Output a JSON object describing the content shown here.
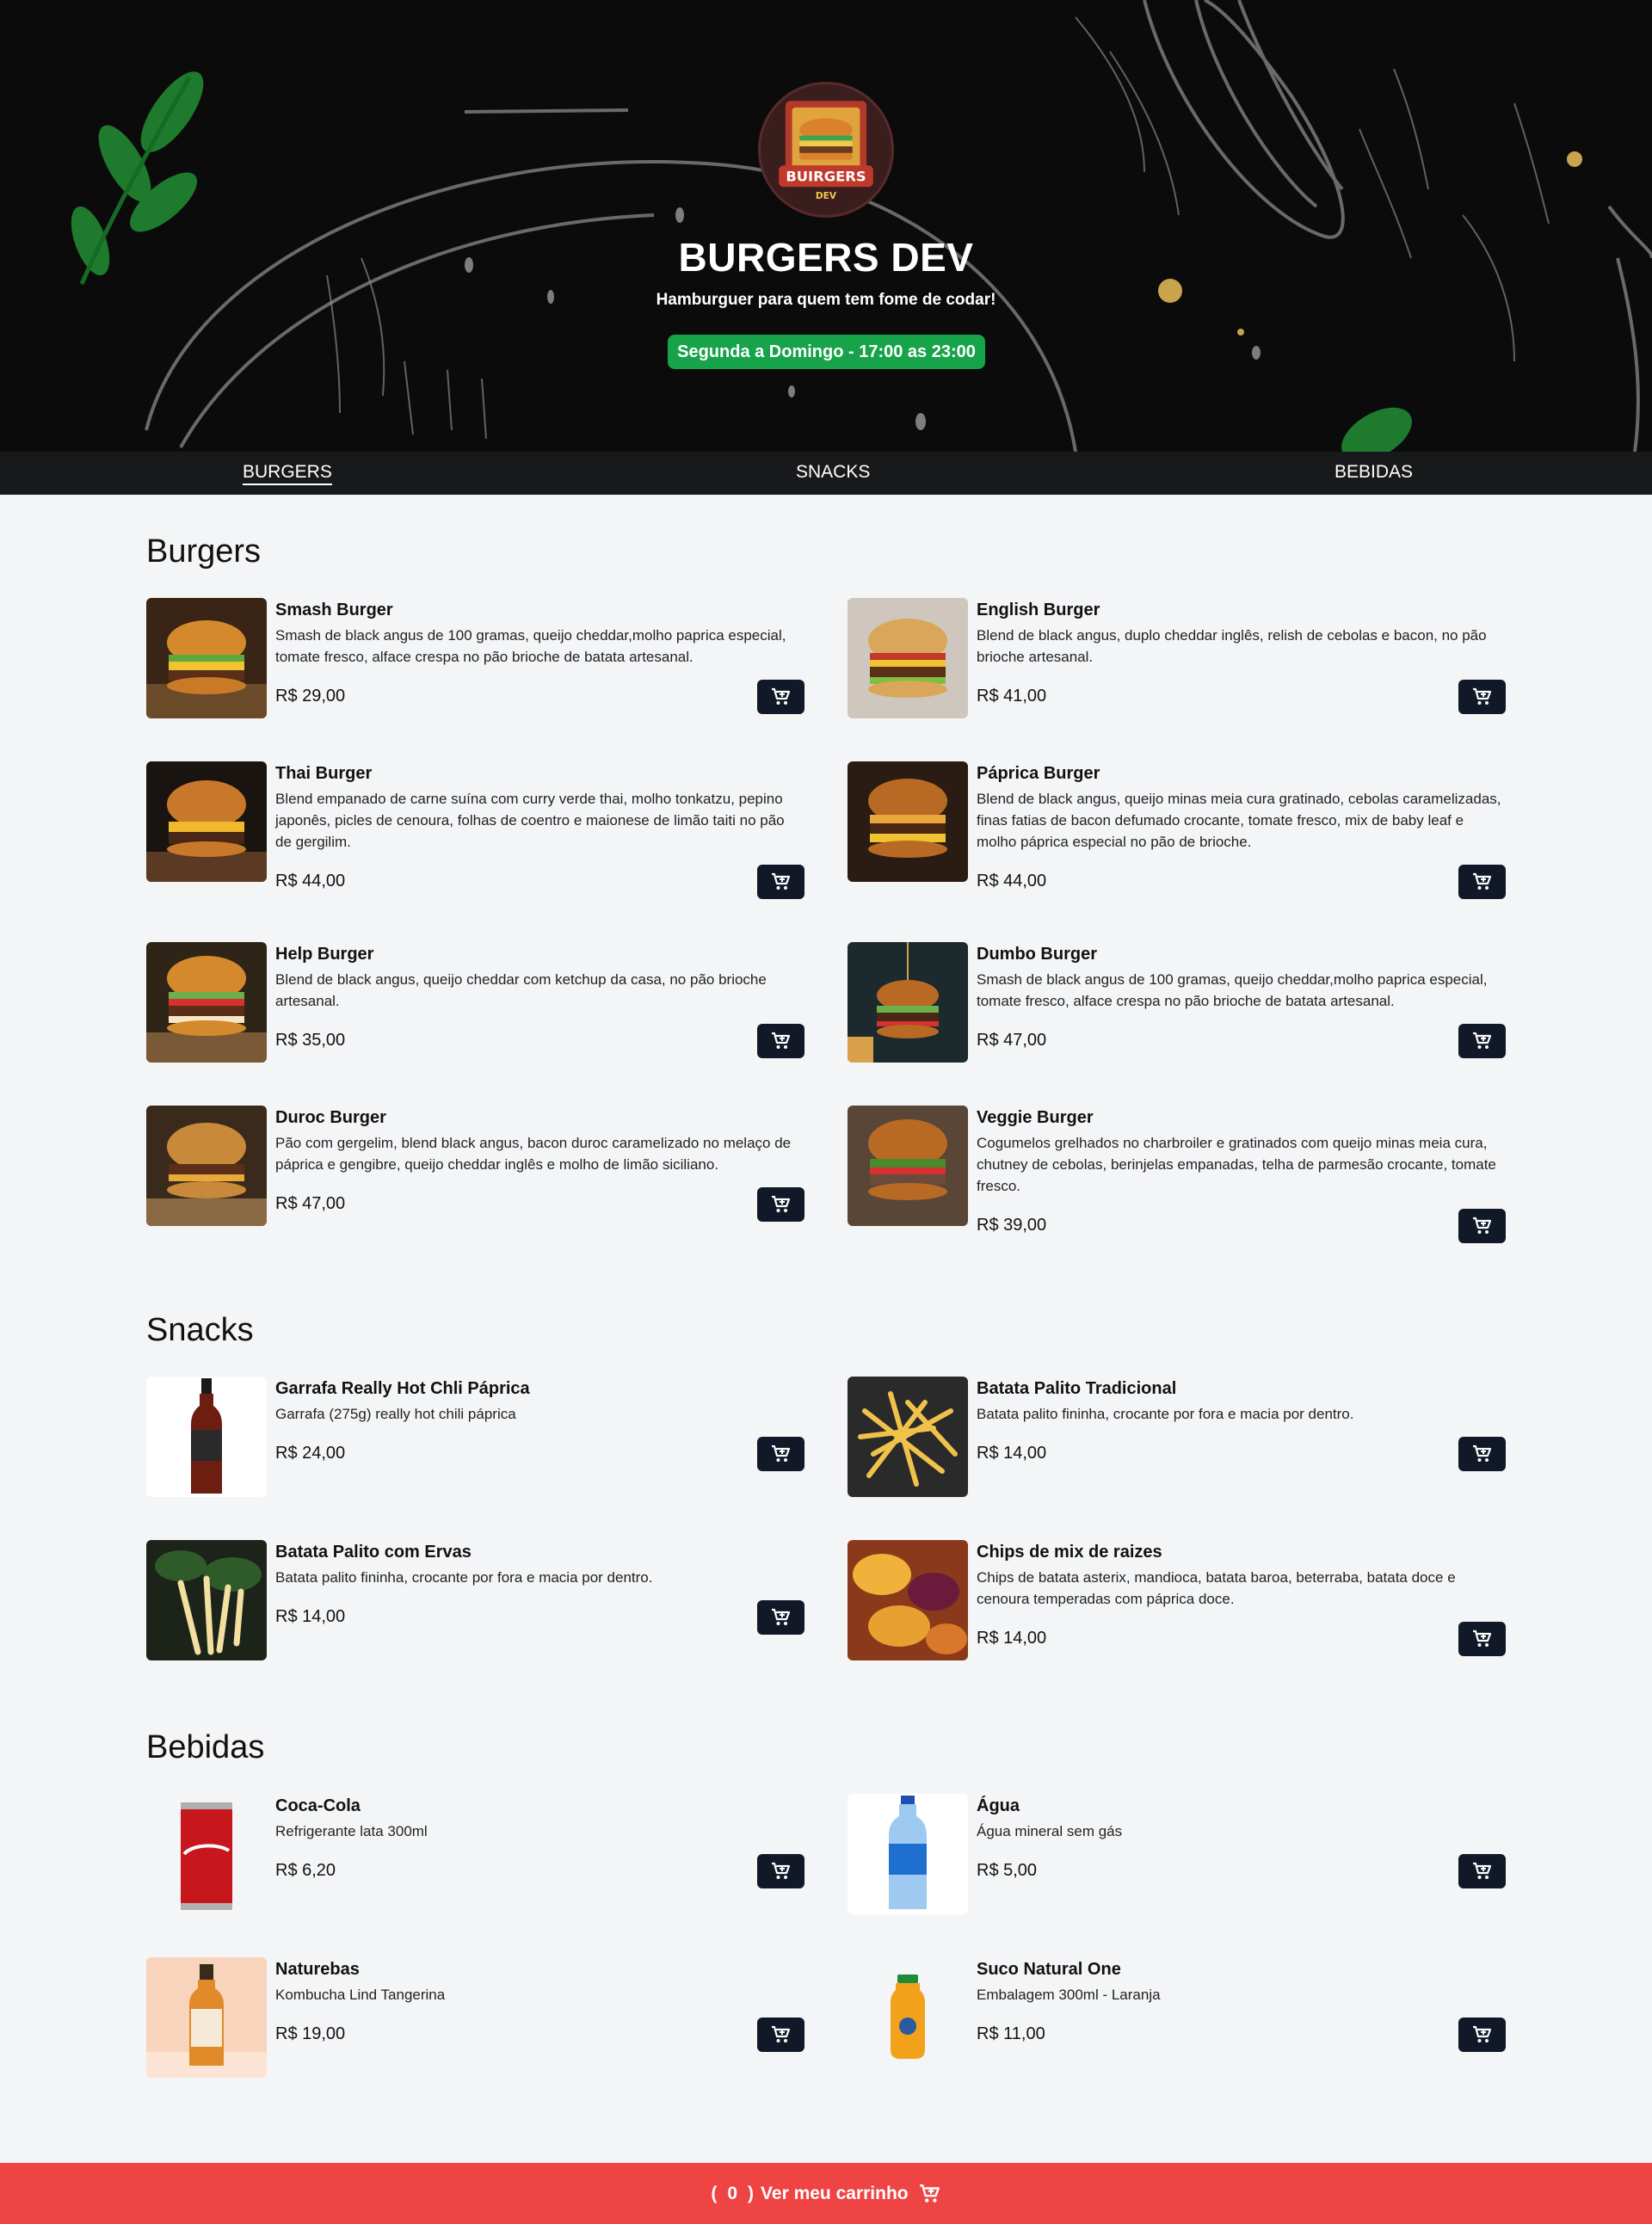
{
  "header": {
    "brand": "BURGERS DEV",
    "tagline": "Hamburguer para quem tem fome de codar!",
    "hours": "Segunda a Domingo - 17:00 as 23:00"
  },
  "nav": {
    "burgers": "BURGERS",
    "snacks": "SNACKS",
    "bebidas": "BEBIDAS"
  },
  "sections": {
    "burgers": "Burgers",
    "snacks": "Snacks",
    "bebidas": "Bebidas"
  },
  "burgers": [
    {
      "name": "Smash Burger",
      "desc": "Smash de black angus de 100 gramas, queijo cheddar,molho paprica especial, tomate fresco, alface crespa no pão brioche de batata artesanal.",
      "price": "R$ 29,00"
    },
    {
      "name": "English Burger",
      "desc": "Blend de black angus, duplo cheddar inglês, relish de cebolas e bacon, no pão brioche artesanal.",
      "price": "R$ 41,00"
    },
    {
      "name": "Thai Burger",
      "desc": "Blend empanado de carne suína com curry verde thai, molho tonkatzu, pepino japonês, picles de cenoura, folhas de coentro e maionese de limão taiti no pão de gergilim.",
      "price": "R$ 44,00"
    },
    {
      "name": "Páprica Burger",
      "desc": "Blend de black angus, queijo minas meia cura gratinado, cebolas caramelizadas, finas fatias de bacon defumado crocante, tomate fresco, mix de baby leaf e molho páprica especial no pão de brioche.",
      "price": "R$ 44,00"
    },
    {
      "name": "Help Burger",
      "desc": "Blend de black angus, queijo cheddar com ketchup da casa, no pão brioche artesanal.",
      "price": "R$ 35,00"
    },
    {
      "name": "Dumbo Burger",
      "desc": "Smash de black angus de 100 gramas, queijo cheddar,molho paprica especial, tomate fresco, alface crespa no pão brioche de batata artesanal.",
      "price": "R$ 47,00"
    },
    {
      "name": "Duroc Burger",
      "desc": "Pão com gergelim, blend black angus, bacon duroc caramelizado no melaço de páprica e gengibre, queijo cheddar inglês e molho de limão siciliano.",
      "price": "R$ 47,00"
    },
    {
      "name": "Veggie Burger",
      "desc": "Cogumelos grelhados no charbroiler e gratinados com queijo minas meia cura, chutney de cebolas, berinjelas empanadas, telha de parmesão crocante, tomate fresco.",
      "price": "R$ 39,00"
    }
  ],
  "snacks": [
    {
      "name": "Garrafa Really Hot Chli Páprica",
      "desc": "Garrafa (275g) really hot chili páprica",
      "price": "R$ 24,00"
    },
    {
      "name": "Batata Palito Tradicional",
      "desc": "Batata palito fininha, crocante por fora e macia por dentro.",
      "price": "R$ 14,00"
    },
    {
      "name": "Batata Palito com Ervas",
      "desc": "Batata palito fininha, crocante por fora e macia por dentro.",
      "price": "R$ 14,00"
    },
    {
      "name": "Chips de mix de raizes",
      "desc": "Chips de batata asterix, mandioca, batata baroa, beterraba, batata doce e cenoura temperadas com páprica doce.",
      "price": "R$ 14,00"
    }
  ],
  "bebidas": [
    {
      "name": "Coca-Cola",
      "desc": "Refrigerante lata 300ml",
      "price": "R$ 6,20"
    },
    {
      "name": "Água",
      "desc": "Água mineral sem gás",
      "price": "R$ 5,00"
    },
    {
      "name": "Naturebas",
      "desc": "Kombucha Lind Tangerina",
      "price": "R$ 19,00"
    },
    {
      "name": "Suco Natural One",
      "desc": "Embalagem 300ml - Laranja",
      "price": "R$ 11,00"
    }
  ],
  "footer": {
    "count_open": "(",
    "count": "0",
    "count_close": ")",
    "label": "Ver meu carrinho"
  },
  "colors": {
    "hero_bg": "#0b0b0c",
    "nav_bg": "#18191b",
    "hours_badge": "#16a34a",
    "cart_button": "#111827",
    "footer_bg": "#ef4444"
  },
  "icons": {
    "cart": "cart-icon",
    "logo": "burger-logo-icon"
  }
}
